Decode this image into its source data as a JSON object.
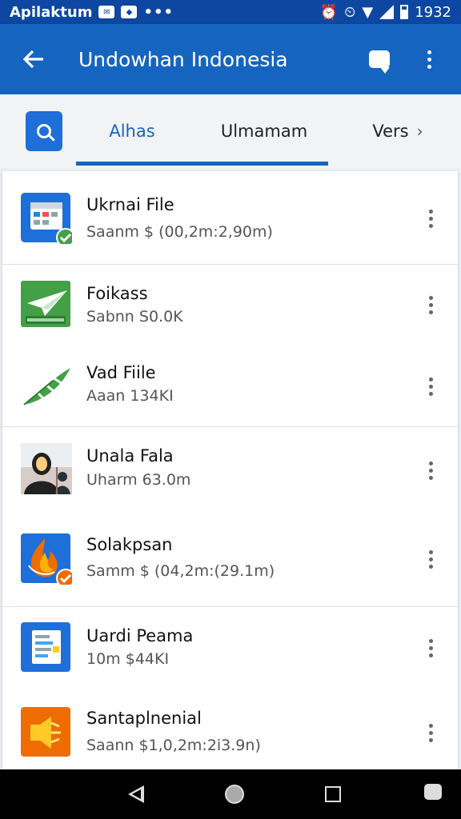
{
  "status_bar": {
    "app_name": "Apilaktum",
    "time": "1932",
    "more": "•••"
  },
  "header": {
    "title": "Undowhan Indonesia",
    "back_icon": "arrow-left-icon",
    "chat_icon": "chat-bubble-icon",
    "menu_icon": "more-vert-icon"
  },
  "tabs": [
    {
      "label": "Alhas",
      "active": true
    },
    {
      "label": "Ulmamam",
      "active": false
    },
    {
      "label": "Vers",
      "active": false
    }
  ],
  "colors": {
    "primary": "#1565c0",
    "status_bar": "#0d47a1",
    "accent_green": "#43a047",
    "accent_orange": "#ef6c00"
  },
  "files": [
    {
      "name": "Ukrnai File",
      "meta": "Saanm $ (00,2m:2,90m)",
      "icon": "calendar-doc-icon"
    },
    {
      "name": "Foikass",
      "meta": "Sabnn S0.0K",
      "icon": "green-plane-icon"
    },
    {
      "name": "Vad Fiile",
      "meta": "Aaan 134KI",
      "icon": "green-feather-icon"
    },
    {
      "name": "Unala Fala",
      "meta": "Uharm 63.0m",
      "icon": "person-photo-icon"
    },
    {
      "name": "Solakpsan",
      "meta": "Samm $ (04,2m:(29.1m)",
      "icon": "flame-icon"
    },
    {
      "name": "Uardi Peama",
      "meta": "10m $44KI",
      "icon": "notes-doc-icon"
    },
    {
      "name": "Santaplnenial",
      "meta": "Saann $1,0,2m:2i3.9n)",
      "icon": "orange-speaker-icon"
    }
  ]
}
